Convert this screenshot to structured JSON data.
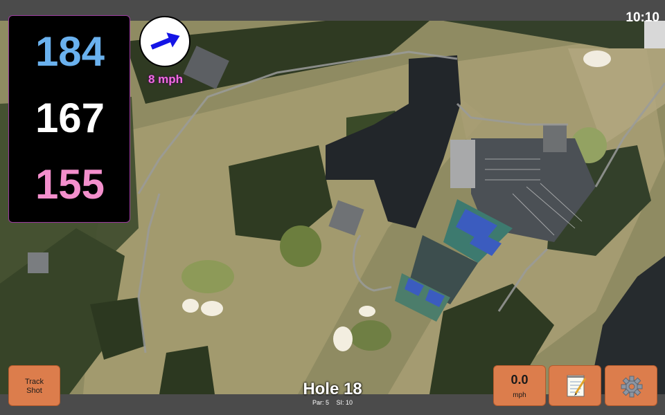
{
  "status": {
    "time": "10:10"
  },
  "distances": {
    "back": "184",
    "middle": "167",
    "front": "155"
  },
  "wind": {
    "speed_label": "8 mph",
    "direction_icon": "wind-arrow-icon",
    "arrow_color": "#1414e6"
  },
  "buttons": {
    "track_shot": {
      "line1": "Track",
      "line2": "Shot"
    },
    "speed": {
      "value": "0.0",
      "unit": "mph"
    },
    "notes_icon": "notepad-icon",
    "settings_icon": "gear-icon"
  },
  "hole": {
    "title": "Hole 18",
    "par": "Par: 5",
    "si": "SI: 10"
  },
  "colors": {
    "button": "#dc7d4c",
    "back_distance": "#6ab1ee",
    "front_distance": "#f38fcc",
    "wind_label": "#f26ce0"
  }
}
